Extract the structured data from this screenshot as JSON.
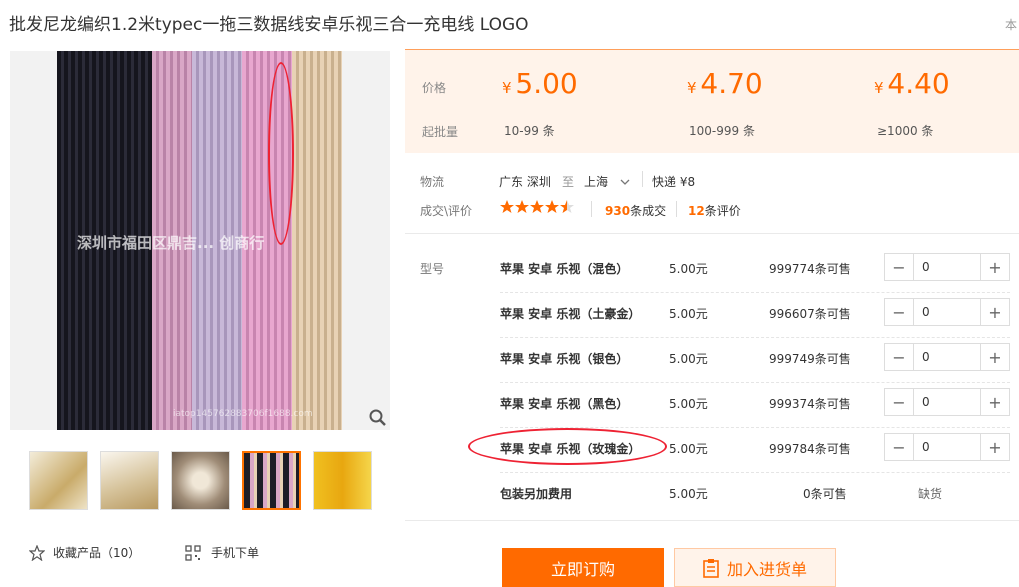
{
  "product": {
    "title": "批发尼龙编织1.2米typec一拖三数据线安卓乐视三合一充电线 LOGO",
    "corner_text": "本",
    "image_watermark": "深圳市福田区鼎吉... 创商行",
    "image_note": "iatop145762883706f1688.com"
  },
  "gallery": {
    "zoom_icon": "magnifier-icon",
    "thumbnails": [
      "thumb-1",
      "thumb-2",
      "thumb-3",
      "thumb-4",
      "thumb-5"
    ],
    "active_index": 3
  },
  "actions": {
    "collect_label": "收藏产品（10）",
    "mobile_label": "手机下单",
    "buy_label": "立即订购",
    "cart_label": "加入进货单"
  },
  "pricing": {
    "price_label": "价格",
    "moq_label": "起批量",
    "currency": "¥",
    "tiers": [
      {
        "price": "5.00",
        "range": "10-99 条"
      },
      {
        "price": "4.70",
        "range": "100-999 条"
      },
      {
        "price": "4.40",
        "range": "≥1000 条"
      }
    ]
  },
  "logistics": {
    "label": "物流",
    "from": "广东 深圳",
    "to_word": "至",
    "to": "上海",
    "shipping": "快递 ¥8"
  },
  "deals": {
    "label": "成交\\评价",
    "stars": 4.5,
    "count": "930",
    "count_suffix": "条成交",
    "reviews": "12",
    "reviews_suffix": "条评价"
  },
  "sku": {
    "label": "型号",
    "rows": [
      {
        "name": "苹果 安卓 乐视（混色）",
        "price": "5.00元",
        "stock": "999774条可售",
        "qty": "0"
      },
      {
        "name": "苹果 安卓 乐视（土豪金）",
        "price": "5.00元",
        "stock": "996607条可售",
        "qty": "0"
      },
      {
        "name": "苹果 安卓 乐视（银色）",
        "price": "5.00元",
        "stock": "999749条可售",
        "qty": "0"
      },
      {
        "name": "苹果 安卓 乐视（黑色）",
        "price": "5.00元",
        "stock": "999374条可售",
        "qty": "0"
      },
      {
        "name": "苹果 安卓 乐视（玫瑰金）",
        "price": "5.00元",
        "stock": "999784条可售",
        "qty": "0"
      },
      {
        "name": "包装另加费用",
        "price": "5.00元",
        "stock": "0条可售",
        "status": "缺货"
      }
    ],
    "minus": "−",
    "plus": "+"
  },
  "colors": {
    "accent": "#ff6a00",
    "annotation": "#e22233"
  }
}
